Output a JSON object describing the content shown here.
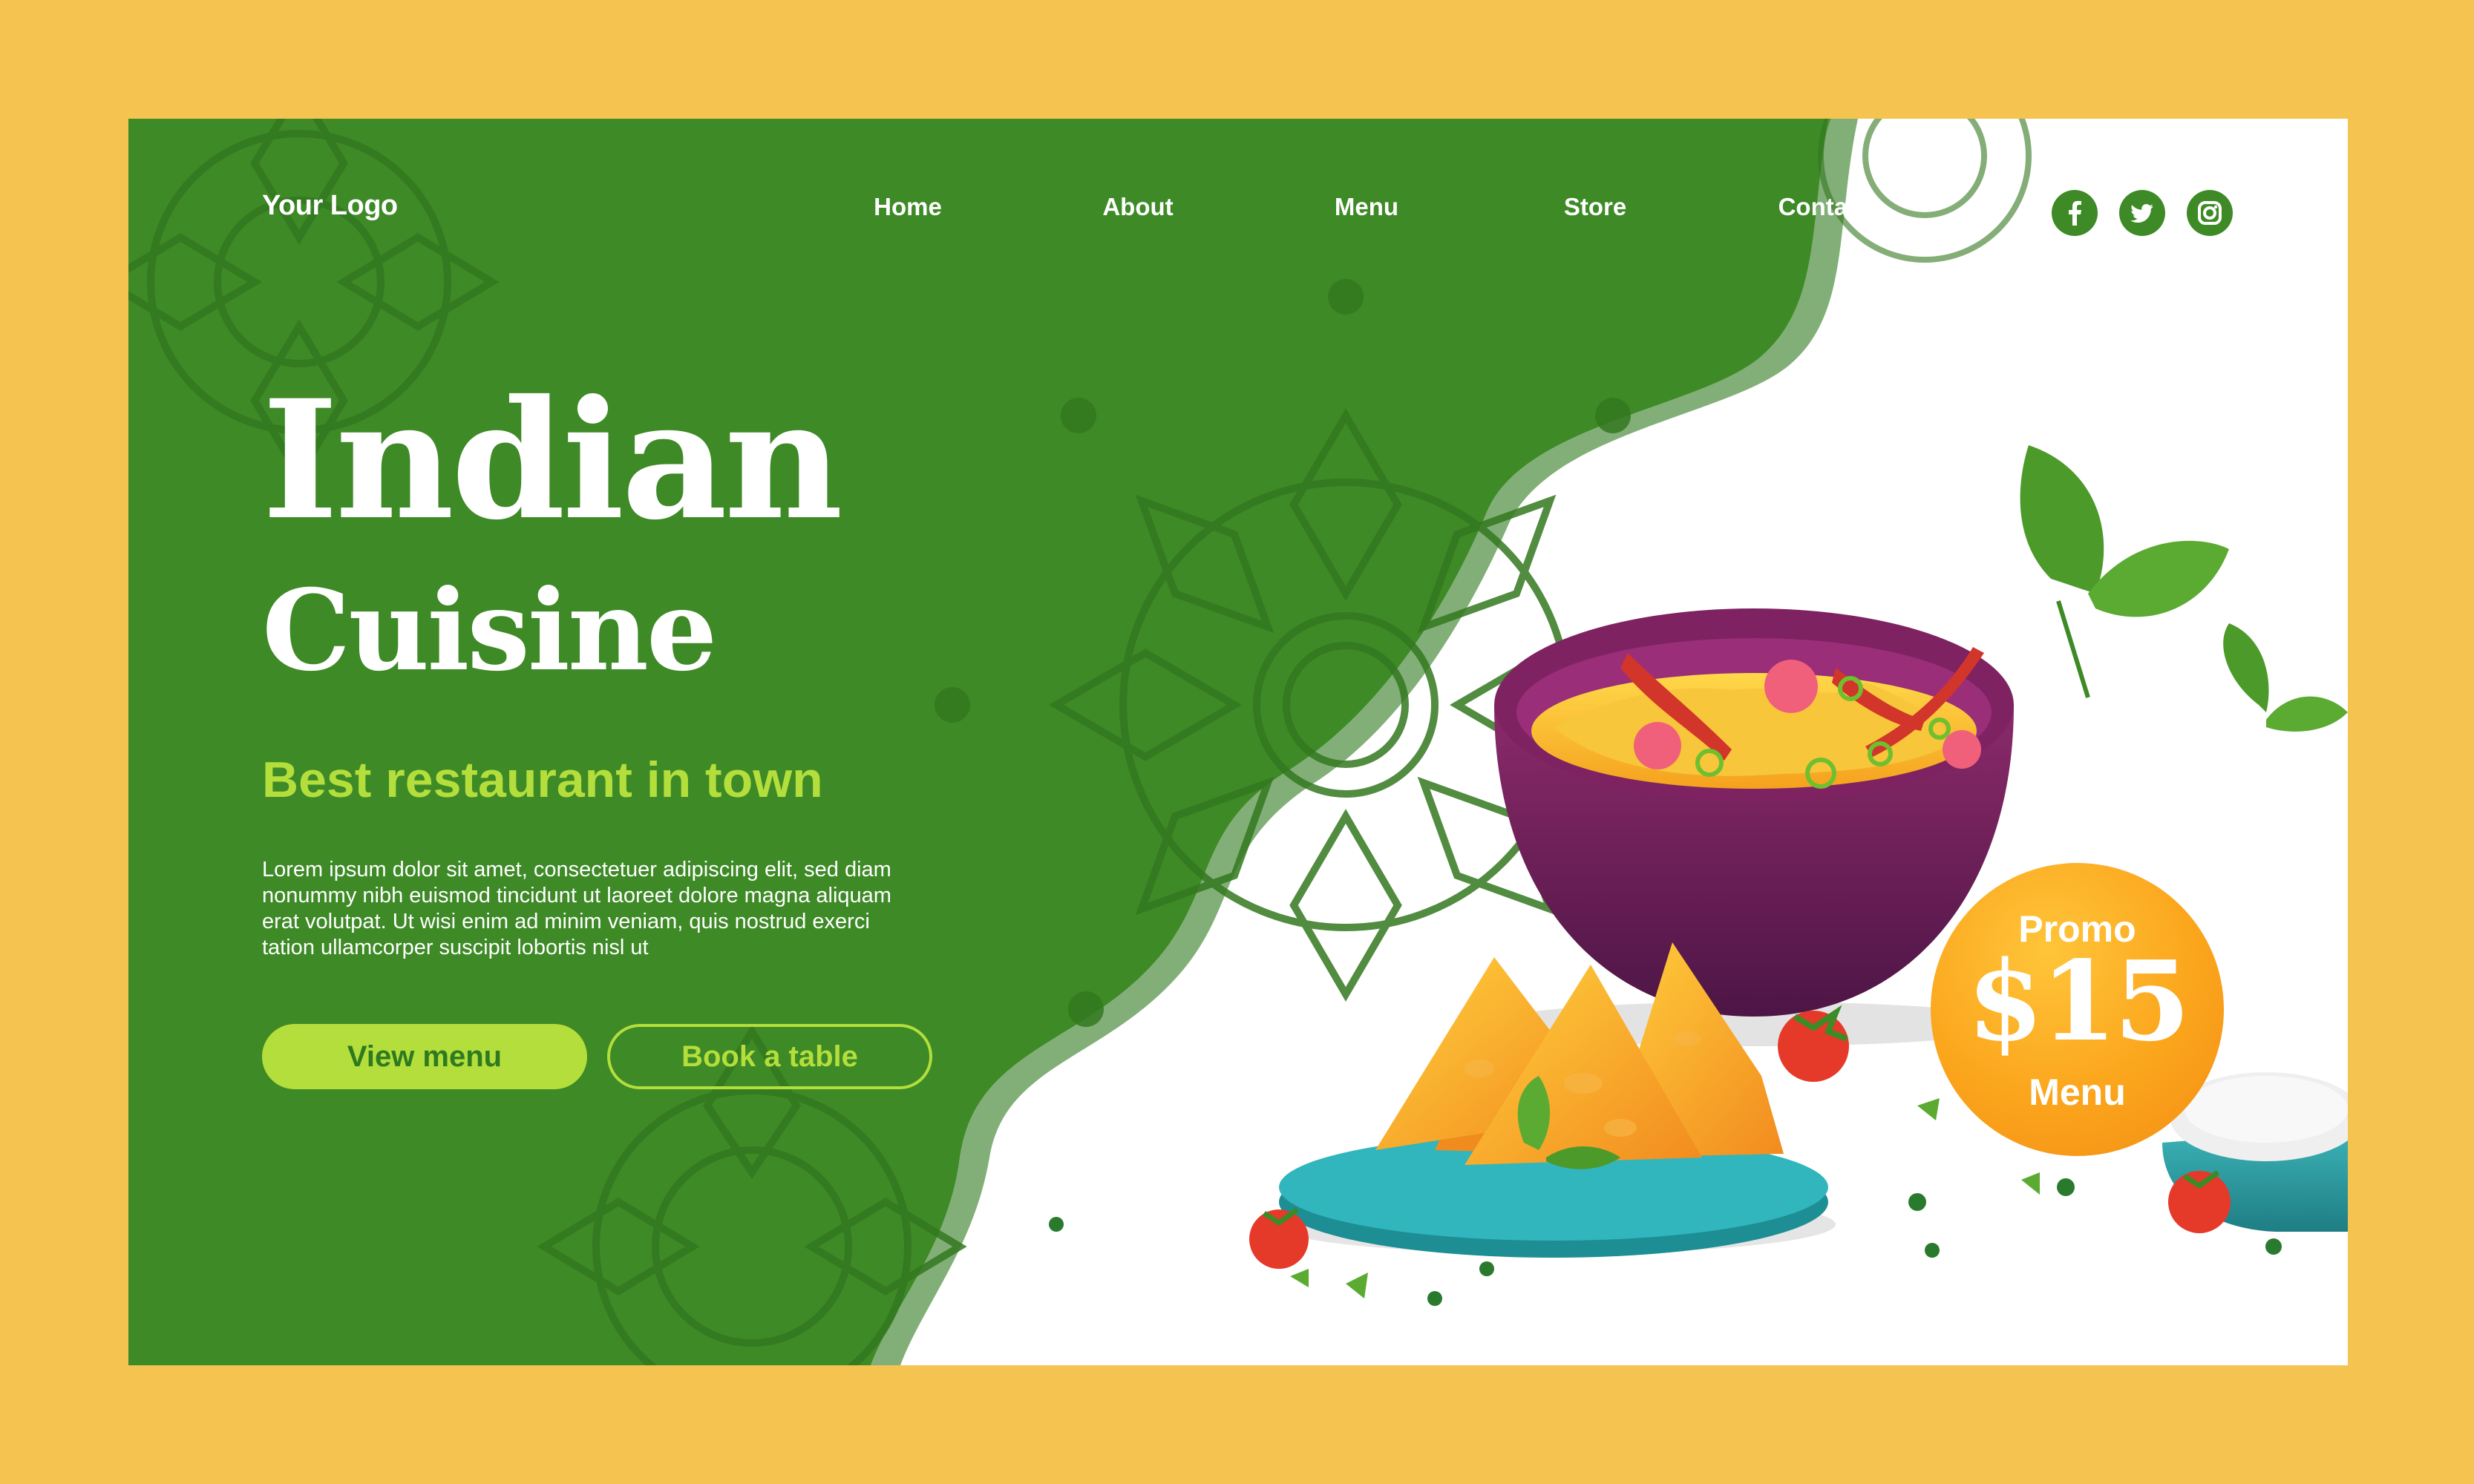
{
  "brand": {
    "logo": "Your Logo"
  },
  "nav": {
    "items": [
      {
        "label": "Home"
      },
      {
        "label": "About"
      },
      {
        "label": "Menu"
      },
      {
        "label": "Store"
      },
      {
        "label": "Contact"
      }
    ]
  },
  "social": [
    "facebook-icon",
    "twitter-icon",
    "instagram-icon"
  ],
  "hero": {
    "title_line1": "Indian",
    "title_line2": "Cuisine",
    "tagline": "Best restaurant in town",
    "body": "Lorem ipsum dolor sit amet, consectetuer adipiscing elit, sed diam nonummy nibh euismod tincidunt ut laoreet dolore magna aliquam erat volutpat. Ut wisi enim ad minim veniam, quis nostrud exerci tation ullamcorper suscipit lobortis nisl ut"
  },
  "buttons": {
    "primary": "View menu",
    "secondary": "Book a table"
  },
  "promo": {
    "top": "Promo",
    "price": "$15",
    "bottom": "Menu"
  },
  "colors": {
    "page_background": "#F5C350",
    "green": "#3D8A26",
    "accent": "#B3DE3C",
    "promo_orange": "#FBA51C",
    "bowl_purple": "#6B1E55"
  }
}
